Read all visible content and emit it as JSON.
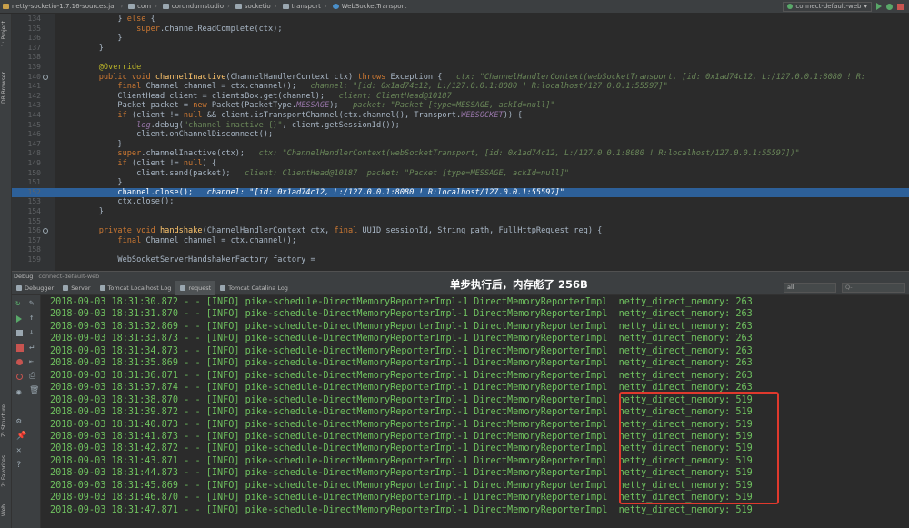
{
  "navbar": {
    "breadcrumbs": [
      {
        "label": "netty-socketio-1.7.16-sources.jar",
        "icon": "jar-icon"
      },
      {
        "label": "com",
        "icon": "package-icon"
      },
      {
        "label": "corundumstudio",
        "icon": "package-icon"
      },
      {
        "label": "socketio",
        "icon": "package-icon"
      },
      {
        "label": "transport",
        "icon": "package-icon"
      },
      {
        "label": "WebSocketTransport",
        "icon": "class-icon"
      }
    ],
    "run_config": "connect-default-web"
  },
  "left_strip": {
    "tabs": [
      "1: Project",
      "DB Browser",
      "Z: Structure",
      "2: Favorites",
      "Web"
    ]
  },
  "editor": {
    "lines": [
      {
        "n": "134",
        "html": "        } <span class=\"kw\">else</span> {"
      },
      {
        "n": "135",
        "html": "            <span class=\"kw\">super</span>.channelReadComplete(ctx);"
      },
      {
        "n": "136",
        "html": "        }"
      },
      {
        "n": "137",
        "html": "    }"
      },
      {
        "n": "138",
        "html": ""
      },
      {
        "n": "139",
        "html": "    <span class=\"an\">@Override</span>"
      },
      {
        "n": "140",
        "html": "    <span class=\"kw\">public void</span> <span class=\"fn\">channelInactive</span>(ChannelHandlerContext ctx) <span class=\"kw\">throws</span> Exception {   <span class=\"hint\">ctx: \"ChannelHandlerContext(webSocketTransport, [id: 0x1ad74c12, L:/127.0.0.1:8080 ! R:</span>"
      },
      {
        "n": "141",
        "html": "        <span class=\"kw\">final</span> Channel channel = ctx.channel();   <span class=\"hint\">channel: \"[id: 0x1ad74c12, L:/127.0.0.1:8080 ! R:localhost/127.0.0.1:55597]\"</span>"
      },
      {
        "n": "142",
        "html": "        ClientHead client = clientsBox.get(channel);   <span class=\"hint\">client: ClientHead@10187</span>"
      },
      {
        "n": "143",
        "html": "        Packet packet = <span class=\"kw\">new</span> Packet(PacketType.<span class=\"fld\">MESSAGE</span>);   <span class=\"hint\">packet: \"Packet [type=MESSAGE, ackId=null]\"</span>"
      },
      {
        "n": "144",
        "html": "        <span class=\"kw\">if</span> (client != <span class=\"kw\">null</span> &amp;&amp; client.isTransportChannel(ctx.channel(), Transport.<span class=\"fld\">WEBSOCKET</span>)) {"
      },
      {
        "n": "145",
        "html": "            <span class=\"logm\">log</span>.debug(<span class=\"str\">\"channel inactive {}\"</span>, client.getSessionId());"
      },
      {
        "n": "146",
        "html": "            client.onChannelDisconnect();"
      },
      {
        "n": "147",
        "html": "        }"
      },
      {
        "n": "148",
        "html": "        <span class=\"kw\">super</span>.channelInactive(ctx);   <span class=\"hint\">ctx: \"ChannelHandlerContext(webSocketTransport, [id: 0x1ad74c12, L:/127.0.0.1:8080 ! R:localhost/127.0.0.1:55597])\"</span>"
      },
      {
        "n": "149",
        "html": "        <span class=\"kw\">if</span> (client != <span class=\"kw\">null</span>) {"
      },
      {
        "n": "150",
        "html": "            client.send(packet);   <span class=\"hint\">client: ClientHead@10187  packet: \"Packet [type=MESSAGE, ackId=null]\"</span>"
      },
      {
        "n": "151",
        "html": "        }"
      },
      {
        "n": "152",
        "html": "        channel.close();   <span class=\"hint\">channel: \"[id: 0x1ad74c12, L:/127.0.0.1:8080 ! R:localhost/127.0.0.1:55597]\"</span>",
        "current": true
      },
      {
        "n": "153",
        "html": "        ctx.close();"
      },
      {
        "n": "154",
        "html": "    }"
      },
      {
        "n": "155",
        "html": ""
      },
      {
        "n": "156",
        "html": "    <span class=\"kw\">private void</span> <span class=\"fn\">handshake</span>(ChannelHandlerContext ctx, <span class=\"kw\">final</span> UUID sessionId, String path, FullHttpRequest req) {"
      },
      {
        "n": "157",
        "html": "        <span class=\"kw\">final</span> Channel channel = ctx.channel();"
      },
      {
        "n": "158",
        "html": ""
      },
      {
        "n": "159",
        "html": "        WebSocketServerHandshakerFactory factory ="
      }
    ]
  },
  "debug": {
    "header_label": "Debug",
    "header_config": "connect-default-web",
    "tabs": [
      "Debugger",
      "Server",
      "Tomcat Localhost Log",
      "request",
      "Tomcat Catalina Log"
    ],
    "filter_value": "all",
    "search_placeholder": "Q-"
  },
  "annotation": "单步执行后，内存彪了 256B",
  "console": {
    "lines": [
      "2018-09-03 18:31:30.872 - - [INFO] pike-schedule-DirectMemoryReporterImpl-1 DirectMemoryReporterImpl  netty_direct_memory: 263",
      "2018-09-03 18:31:31.870 - - [INFO] pike-schedule-DirectMemoryReporterImpl-1 DirectMemoryReporterImpl  netty_direct_memory: 263",
      "2018-09-03 18:31:32.869 - - [INFO] pike-schedule-DirectMemoryReporterImpl-1 DirectMemoryReporterImpl  netty_direct_memory: 263",
      "2018-09-03 18:31:33.873 - - [INFO] pike-schedule-DirectMemoryReporterImpl-1 DirectMemoryReporterImpl  netty_direct_memory: 263",
      "2018-09-03 18:31:34.873 - - [INFO] pike-schedule-DirectMemoryReporterImpl-1 DirectMemoryReporterImpl  netty_direct_memory: 263",
      "2018-09-03 18:31:35.869 - - [INFO] pike-schedule-DirectMemoryReporterImpl-1 DirectMemoryReporterImpl  netty_direct_memory: 263",
      "2018-09-03 18:31:36.871 - - [INFO] pike-schedule-DirectMemoryReporterImpl-1 DirectMemoryReporterImpl  netty_direct_memory: 263",
      "2018-09-03 18:31:37.874 - - [INFO] pike-schedule-DirectMemoryReporterImpl-1 DirectMemoryReporterImpl  netty_direct_memory: 263",
      "2018-09-03 18:31:38.870 - - [INFO] pike-schedule-DirectMemoryReporterImpl-1 DirectMemoryReporterImpl  netty_direct_memory: 519",
      "2018-09-03 18:31:39.872 - - [INFO] pike-schedule-DirectMemoryReporterImpl-1 DirectMemoryReporterImpl  netty_direct_memory: 519",
      "2018-09-03 18:31:40.873 - - [INFO] pike-schedule-DirectMemoryReporterImpl-1 DirectMemoryReporterImpl  netty_direct_memory: 519",
      "2018-09-03 18:31:41.873 - - [INFO] pike-schedule-DirectMemoryReporterImpl-1 DirectMemoryReporterImpl  netty_direct_memory: 519",
      "2018-09-03 18:31:42.872 - - [INFO] pike-schedule-DirectMemoryReporterImpl-1 DirectMemoryReporterImpl  netty_direct_memory: 519",
      "2018-09-03 18:31:43.871 - - [INFO] pike-schedule-DirectMemoryReporterImpl-1 DirectMemoryReporterImpl  netty_direct_memory: 519",
      "2018-09-03 18:31:44.873 - - [INFO] pike-schedule-DirectMemoryReporterImpl-1 DirectMemoryReporterImpl  netty_direct_memory: 519",
      "2018-09-03 18:31:45.869 - - [INFO] pike-schedule-DirectMemoryReporterImpl-1 DirectMemoryReporterImpl  netty_direct_memory: 519",
      "2018-09-03 18:31:46.870 - - [INFO] pike-schedule-DirectMemoryReporterImpl-1 DirectMemoryReporterImpl  netty_direct_memory: 519",
      "2018-09-03 18:31:47.871 - - [INFO] pike-schedule-DirectMemoryReporterImpl-1 DirectMemoryReporterImpl  netty_direct_memory: 519"
    ]
  },
  "colors": {
    "log_text": "#6fc15f",
    "highlight": "#e0392d",
    "current_line": "#2d6099"
  }
}
